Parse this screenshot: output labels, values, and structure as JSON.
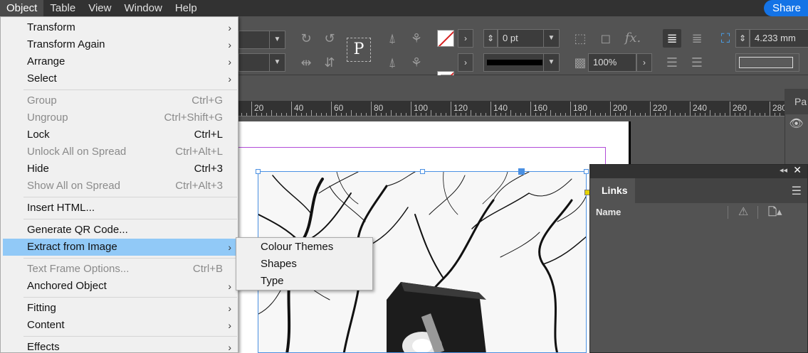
{
  "menubar": {
    "items": [
      "Object",
      "Table",
      "View",
      "Window",
      "Help"
    ],
    "share_label": "Share"
  },
  "controlbar": {
    "stroke_weight": "0 pt",
    "opacity": "100%",
    "dimension": "4.233 mm",
    "text_wrap_glyph": "P"
  },
  "ruler": {
    "labels": [
      "20",
      "40",
      "60",
      "80",
      "100",
      "120",
      "140",
      "160",
      "180",
      "200",
      "220",
      "240",
      "260",
      "280"
    ]
  },
  "object_menu": {
    "items": [
      {
        "label": "Transform",
        "submenu": true,
        "enabled": true
      },
      {
        "label": "Transform Again",
        "submenu": true,
        "enabled": true
      },
      {
        "label": "Arrange",
        "submenu": true,
        "enabled": true
      },
      {
        "label": "Select",
        "submenu": true,
        "enabled": true
      },
      {
        "label": "Group",
        "shortcut": "Ctrl+G",
        "enabled": false
      },
      {
        "label": "Ungroup",
        "shortcut": "Ctrl+Shift+G",
        "enabled": false
      },
      {
        "label": "Lock",
        "shortcut": "Ctrl+L",
        "enabled": true
      },
      {
        "label": "Unlock All on Spread",
        "shortcut": "Ctrl+Alt+L",
        "enabled": false
      },
      {
        "label": "Hide",
        "shortcut": "Ctrl+3",
        "enabled": true
      },
      {
        "label": "Show All on Spread",
        "shortcut": "Ctrl+Alt+3",
        "enabled": false
      },
      {
        "label": "Insert HTML...",
        "enabled": true
      },
      {
        "label": "Generate QR Code...",
        "enabled": true
      },
      {
        "label": "Extract from Image",
        "submenu": true,
        "enabled": true,
        "highlighted": true
      },
      {
        "label": "Text Frame Options...",
        "shortcut": "Ctrl+B",
        "enabled": false
      },
      {
        "label": "Anchored Object",
        "submenu": true,
        "enabled": true
      },
      {
        "label": "Fitting",
        "submenu": true,
        "enabled": true
      },
      {
        "label": "Content",
        "submenu": true,
        "enabled": true
      },
      {
        "label": "Effects",
        "submenu": true,
        "enabled": true
      }
    ]
  },
  "submenu": {
    "items": [
      "Colour Themes",
      "Shapes",
      "Type"
    ]
  },
  "links_panel": {
    "tab_label": "Links",
    "column_name": "Name"
  },
  "right_panel": {
    "tab_label": "Pa"
  },
  "colors": {
    "menu_highlight": "#91c9f7",
    "accent_blue": "#1473e6",
    "margin_guide": "#b24bd8",
    "frame_blue": "#4a90e2"
  }
}
